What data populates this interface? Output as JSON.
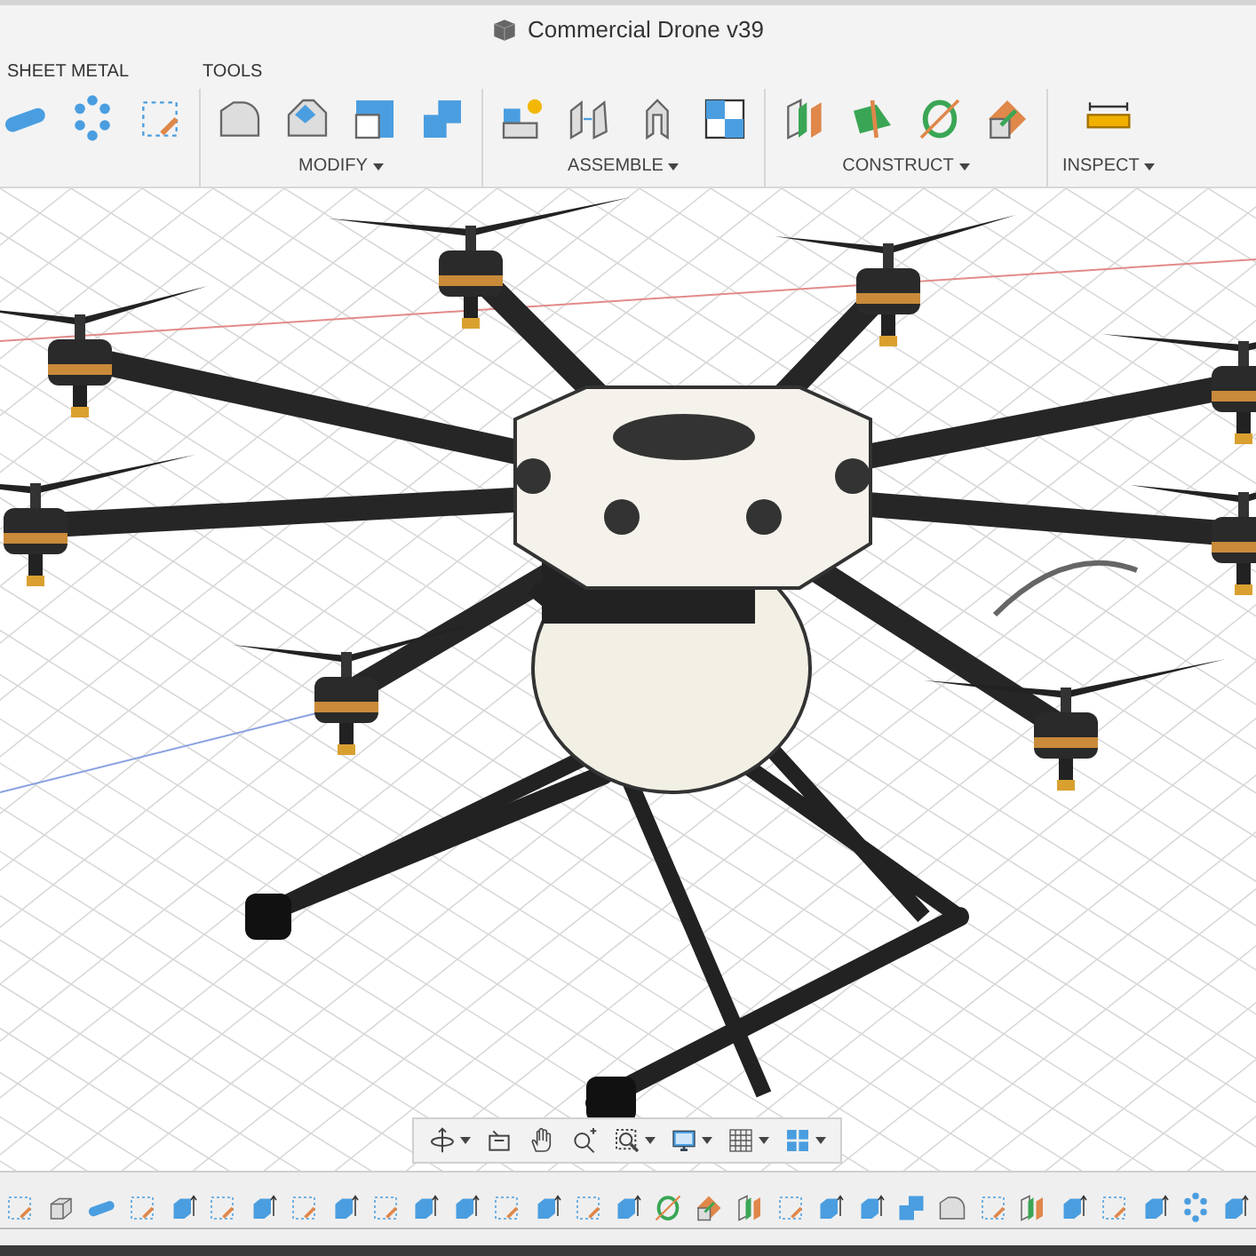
{
  "window": {
    "title": "Commercial Drone v39"
  },
  "tabs": [
    {
      "label": "SHEET METAL"
    },
    {
      "label": "TOOLS"
    }
  ],
  "ribbon_groups": [
    {
      "tools": [
        {
          "kind": "pipe"
        },
        {
          "kind": "pattern"
        },
        {
          "kind": "sketch"
        }
      ]
    },
    {
      "label": "MODIFY",
      "dropdown": true,
      "tools": [
        {
          "kind": "fillet"
        },
        {
          "kind": "chamfer"
        },
        {
          "kind": "shell"
        },
        {
          "kind": "combine"
        }
      ]
    },
    {
      "label": "ASSEMBLE",
      "dropdown": true,
      "tools": [
        {
          "kind": "new-component"
        },
        {
          "kind": "joint"
        },
        {
          "kind": "as-built-joint"
        },
        {
          "kind": "rigid-group"
        }
      ]
    },
    {
      "label": "CONSTRUCT",
      "dropdown": true,
      "tools": [
        {
          "kind": "offset-plane"
        },
        {
          "kind": "angle-plane"
        },
        {
          "kind": "axis"
        },
        {
          "kind": "plane-point"
        }
      ]
    },
    {
      "label": "INSPECT",
      "dropdown": true,
      "tools": [
        {
          "kind": "measure"
        }
      ]
    }
  ],
  "nav_tools": [
    {
      "kind": "orbit",
      "dropdown": true
    },
    {
      "kind": "look-at",
      "dropdown": false
    },
    {
      "kind": "pan",
      "dropdown": false
    },
    {
      "kind": "zoom",
      "dropdown": false
    },
    {
      "kind": "fit",
      "dropdown": true
    },
    {
      "kind": "display",
      "dropdown": true
    },
    {
      "kind": "grid",
      "dropdown": true
    },
    {
      "kind": "viewports",
      "dropdown": true
    }
  ],
  "timeline": [
    {
      "kind": "sketch"
    },
    {
      "kind": "box"
    },
    {
      "kind": "pipe"
    },
    {
      "kind": "sketch"
    },
    {
      "kind": "extrude"
    },
    {
      "kind": "sketch"
    },
    {
      "kind": "extrude"
    },
    {
      "kind": "sketch"
    },
    {
      "kind": "extrude"
    },
    {
      "kind": "sketch"
    },
    {
      "kind": "extrude"
    },
    {
      "kind": "extrude"
    },
    {
      "kind": "sketch"
    },
    {
      "kind": "extrude"
    },
    {
      "kind": "sketch"
    },
    {
      "kind": "extrude"
    },
    {
      "kind": "axis"
    },
    {
      "kind": "plane-point"
    },
    {
      "kind": "offset-plane"
    },
    {
      "kind": "sketch"
    },
    {
      "kind": "extrude"
    },
    {
      "kind": "extrude"
    },
    {
      "kind": "combine"
    },
    {
      "kind": "fillet"
    },
    {
      "kind": "sketch"
    },
    {
      "kind": "offset-plane"
    },
    {
      "kind": "extrude"
    },
    {
      "kind": "sketch"
    },
    {
      "kind": "extrude"
    },
    {
      "kind": "pattern"
    },
    {
      "kind": "extrude"
    }
  ]
}
